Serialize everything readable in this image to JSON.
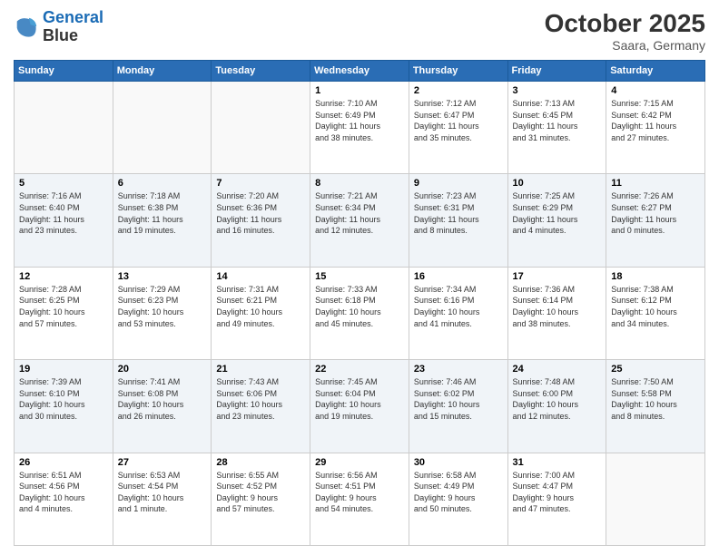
{
  "header": {
    "logo_line1": "General",
    "logo_line2": "Blue",
    "month_title": "October 2025",
    "location": "Saara, Germany"
  },
  "weekdays": [
    "Sunday",
    "Monday",
    "Tuesday",
    "Wednesday",
    "Thursday",
    "Friday",
    "Saturday"
  ],
  "weeks": [
    [
      {
        "day": "",
        "info": ""
      },
      {
        "day": "",
        "info": ""
      },
      {
        "day": "",
        "info": ""
      },
      {
        "day": "1",
        "info": "Sunrise: 7:10 AM\nSunset: 6:49 PM\nDaylight: 11 hours\nand 38 minutes."
      },
      {
        "day": "2",
        "info": "Sunrise: 7:12 AM\nSunset: 6:47 PM\nDaylight: 11 hours\nand 35 minutes."
      },
      {
        "day": "3",
        "info": "Sunrise: 7:13 AM\nSunset: 6:45 PM\nDaylight: 11 hours\nand 31 minutes."
      },
      {
        "day": "4",
        "info": "Sunrise: 7:15 AM\nSunset: 6:42 PM\nDaylight: 11 hours\nand 27 minutes."
      }
    ],
    [
      {
        "day": "5",
        "info": "Sunrise: 7:16 AM\nSunset: 6:40 PM\nDaylight: 11 hours\nand 23 minutes."
      },
      {
        "day": "6",
        "info": "Sunrise: 7:18 AM\nSunset: 6:38 PM\nDaylight: 11 hours\nand 19 minutes."
      },
      {
        "day": "7",
        "info": "Sunrise: 7:20 AM\nSunset: 6:36 PM\nDaylight: 11 hours\nand 16 minutes."
      },
      {
        "day": "8",
        "info": "Sunrise: 7:21 AM\nSunset: 6:34 PM\nDaylight: 11 hours\nand 12 minutes."
      },
      {
        "day": "9",
        "info": "Sunrise: 7:23 AM\nSunset: 6:31 PM\nDaylight: 11 hours\nand 8 minutes."
      },
      {
        "day": "10",
        "info": "Sunrise: 7:25 AM\nSunset: 6:29 PM\nDaylight: 11 hours\nand 4 minutes."
      },
      {
        "day": "11",
        "info": "Sunrise: 7:26 AM\nSunset: 6:27 PM\nDaylight: 11 hours\nand 0 minutes."
      }
    ],
    [
      {
        "day": "12",
        "info": "Sunrise: 7:28 AM\nSunset: 6:25 PM\nDaylight: 10 hours\nand 57 minutes."
      },
      {
        "day": "13",
        "info": "Sunrise: 7:29 AM\nSunset: 6:23 PM\nDaylight: 10 hours\nand 53 minutes."
      },
      {
        "day": "14",
        "info": "Sunrise: 7:31 AM\nSunset: 6:21 PM\nDaylight: 10 hours\nand 49 minutes."
      },
      {
        "day": "15",
        "info": "Sunrise: 7:33 AM\nSunset: 6:18 PM\nDaylight: 10 hours\nand 45 minutes."
      },
      {
        "day": "16",
        "info": "Sunrise: 7:34 AM\nSunset: 6:16 PM\nDaylight: 10 hours\nand 41 minutes."
      },
      {
        "day": "17",
        "info": "Sunrise: 7:36 AM\nSunset: 6:14 PM\nDaylight: 10 hours\nand 38 minutes."
      },
      {
        "day": "18",
        "info": "Sunrise: 7:38 AM\nSunset: 6:12 PM\nDaylight: 10 hours\nand 34 minutes."
      }
    ],
    [
      {
        "day": "19",
        "info": "Sunrise: 7:39 AM\nSunset: 6:10 PM\nDaylight: 10 hours\nand 30 minutes."
      },
      {
        "day": "20",
        "info": "Sunrise: 7:41 AM\nSunset: 6:08 PM\nDaylight: 10 hours\nand 26 minutes."
      },
      {
        "day": "21",
        "info": "Sunrise: 7:43 AM\nSunset: 6:06 PM\nDaylight: 10 hours\nand 23 minutes."
      },
      {
        "day": "22",
        "info": "Sunrise: 7:45 AM\nSunset: 6:04 PM\nDaylight: 10 hours\nand 19 minutes."
      },
      {
        "day": "23",
        "info": "Sunrise: 7:46 AM\nSunset: 6:02 PM\nDaylight: 10 hours\nand 15 minutes."
      },
      {
        "day": "24",
        "info": "Sunrise: 7:48 AM\nSunset: 6:00 PM\nDaylight: 10 hours\nand 12 minutes."
      },
      {
        "day": "25",
        "info": "Sunrise: 7:50 AM\nSunset: 5:58 PM\nDaylight: 10 hours\nand 8 minutes."
      }
    ],
    [
      {
        "day": "26",
        "info": "Sunrise: 6:51 AM\nSunset: 4:56 PM\nDaylight: 10 hours\nand 4 minutes."
      },
      {
        "day": "27",
        "info": "Sunrise: 6:53 AM\nSunset: 4:54 PM\nDaylight: 10 hours\nand 1 minute."
      },
      {
        "day": "28",
        "info": "Sunrise: 6:55 AM\nSunset: 4:52 PM\nDaylight: 9 hours\nand 57 minutes."
      },
      {
        "day": "29",
        "info": "Sunrise: 6:56 AM\nSunset: 4:51 PM\nDaylight: 9 hours\nand 54 minutes."
      },
      {
        "day": "30",
        "info": "Sunrise: 6:58 AM\nSunset: 4:49 PM\nDaylight: 9 hours\nand 50 minutes."
      },
      {
        "day": "31",
        "info": "Sunrise: 7:00 AM\nSunset: 4:47 PM\nDaylight: 9 hours\nand 47 minutes."
      },
      {
        "day": "",
        "info": ""
      }
    ]
  ]
}
